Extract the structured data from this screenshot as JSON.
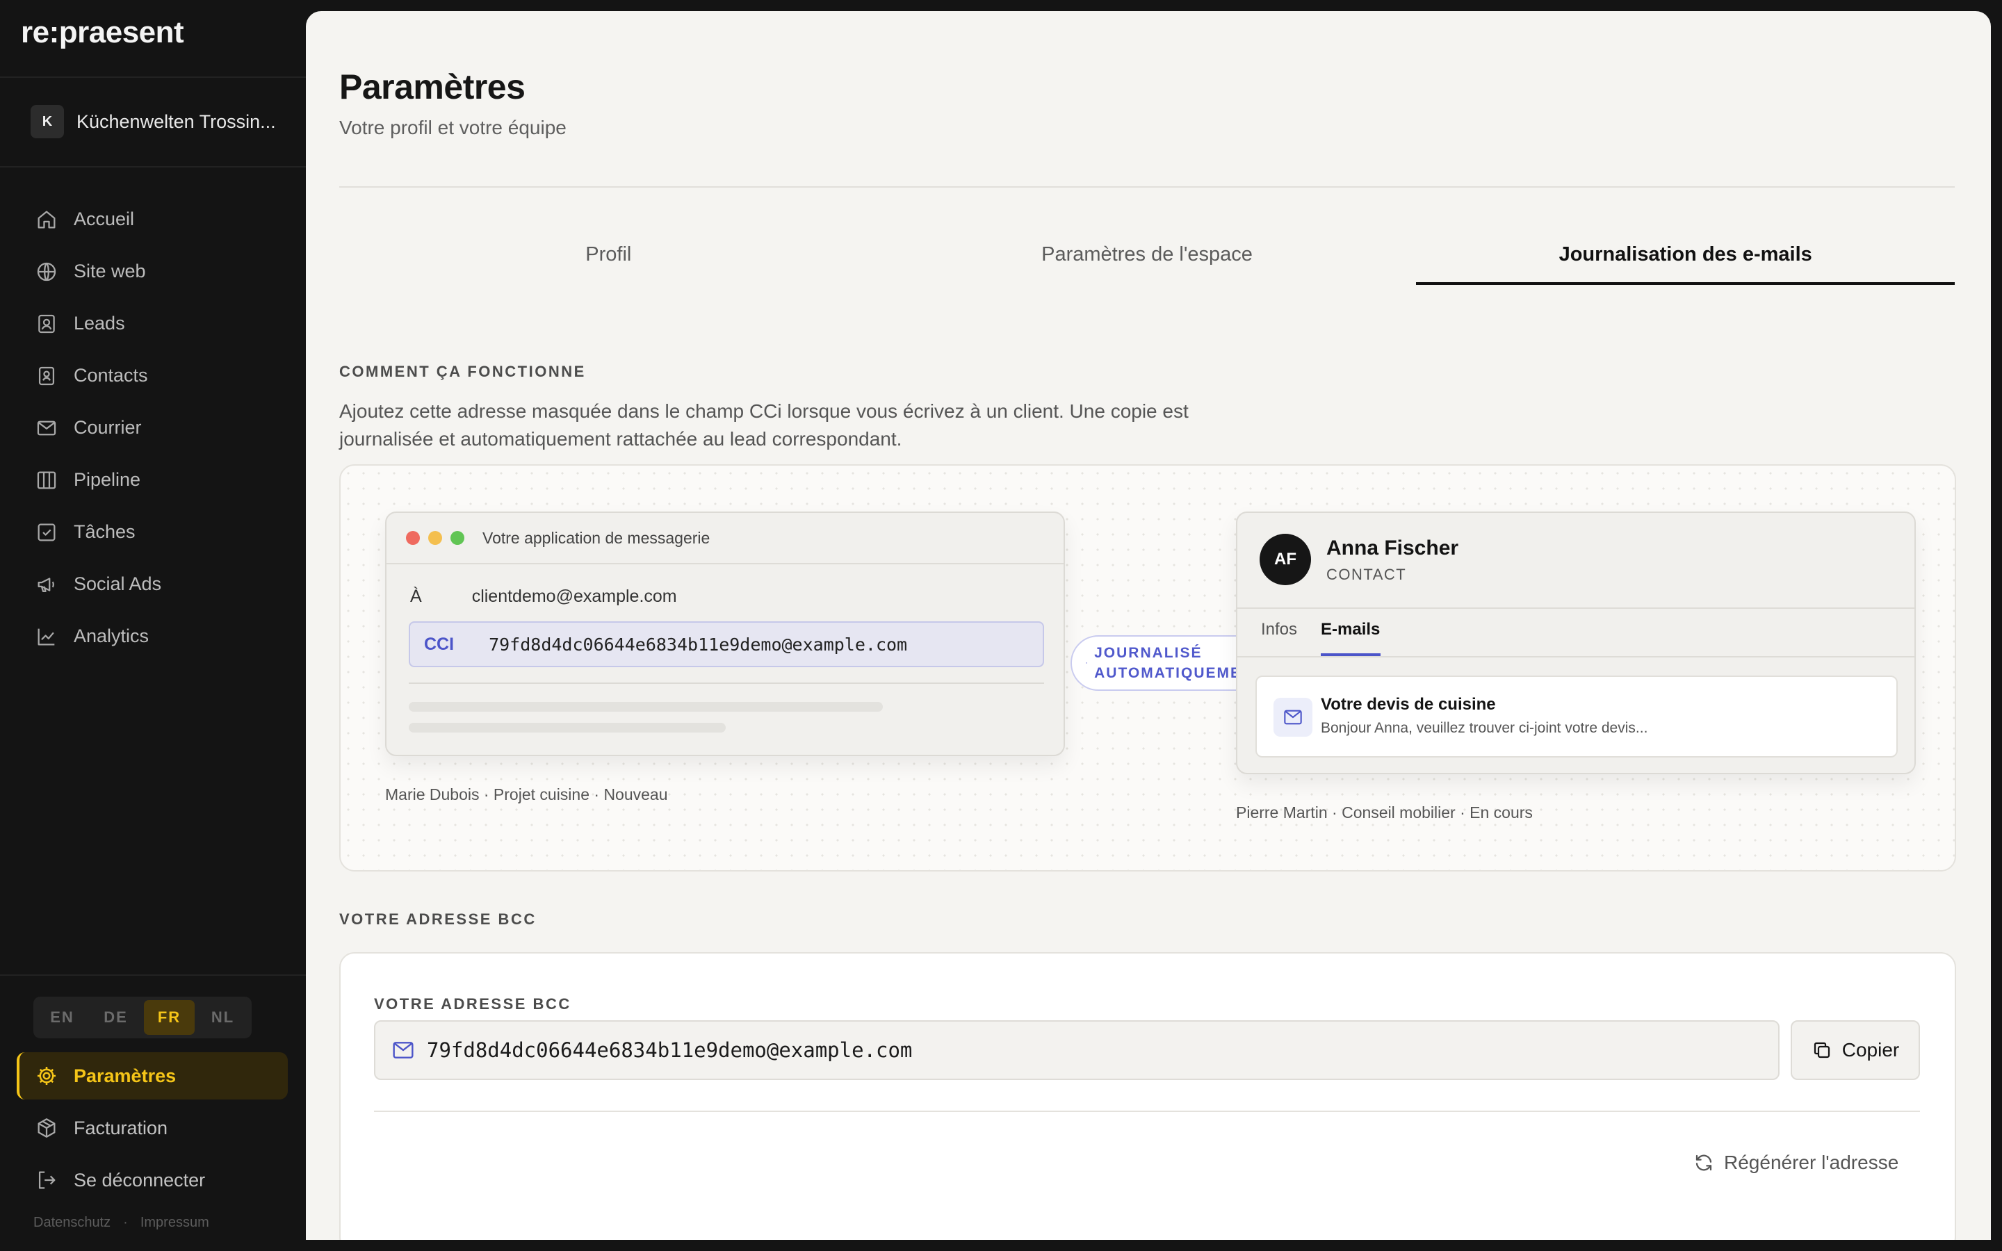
{
  "brand": "re:praesent",
  "workspace": {
    "initial": "K",
    "name": "Küchenwelten Trossin..."
  },
  "nav": [
    {
      "label": "Accueil",
      "icon": "home-icon"
    },
    {
      "label": "Site web",
      "icon": "globe-icon"
    },
    {
      "label": "Leads",
      "icon": "leads-icon"
    },
    {
      "label": "Contacts",
      "icon": "contacts-icon"
    },
    {
      "label": "Courrier",
      "icon": "mail-icon"
    },
    {
      "label": "Pipeline",
      "icon": "pipeline-icon"
    },
    {
      "label": "Tâches",
      "icon": "tasks-icon"
    },
    {
      "label": "Social Ads",
      "icon": "megaphone-icon"
    },
    {
      "label": "Analytics",
      "icon": "chart-icon"
    }
  ],
  "languages": [
    "EN",
    "DE",
    "FR",
    "NL"
  ],
  "active_language": "FR",
  "bottom_nav": {
    "settings": "Paramètres",
    "billing": "Facturation",
    "logout": "Se déconnecter"
  },
  "footer": {
    "privacy": "Datenschutz",
    "separator": "·",
    "imprint": "Impressum"
  },
  "page": {
    "title": "Paramètres",
    "subtitle": "Votre profil et votre équipe"
  },
  "tabs": [
    "Profil",
    "Paramètres de l'espace",
    "Journalisation des e-mails"
  ],
  "active_tab": "Journalisation des e-mails",
  "how_it_works": {
    "label": "COMMENT ÇA FONCTIONNE",
    "description": "Ajoutez cette adresse masquée dans le champ CCi lorsque vous écrivez à un client. Une copie est journalisée et automatiquement rattachée au lead correspondant."
  },
  "demo": {
    "mail_window_title": "Votre application de messagerie",
    "to_label": "À",
    "to_value": "clientdemo@example.com",
    "cci_label": "CCI",
    "cci_value": "79fd8d4dc06644e6834b11e9demo@example.com",
    "pill": "JOURNALISÉ\nAUTOMATIQUEMENT",
    "left_caption": "Marie Dubois · Projet cuisine · Nouveau",
    "contact": {
      "initials": "AF",
      "name": "Anna Fischer",
      "role": "CONTACT",
      "tab_info": "Infos",
      "tab_emails": "E-mails",
      "mail_title": "Votre devis de cuisine",
      "mail_snippet": "Bonjour Anna, veuillez trouver ci-joint votre devis..."
    },
    "right_caption": "Pierre Martin · Conseil mobilier · En cours"
  },
  "bcc": {
    "section_label": "VOTRE ADRESSE BCC",
    "field_label": "VOTRE ADRESSE BCC",
    "address": "79fd8d4dc06644e6834b11e9demo@example.com",
    "copy_label": "Copier",
    "regenerate_label": "Régénérer l'adresse"
  },
  "colors": {
    "accent_yellow": "#f5c518",
    "accent_indigo": "#4c55c9",
    "sidebar_bg": "#141414",
    "main_bg": "#f5f4f1"
  }
}
